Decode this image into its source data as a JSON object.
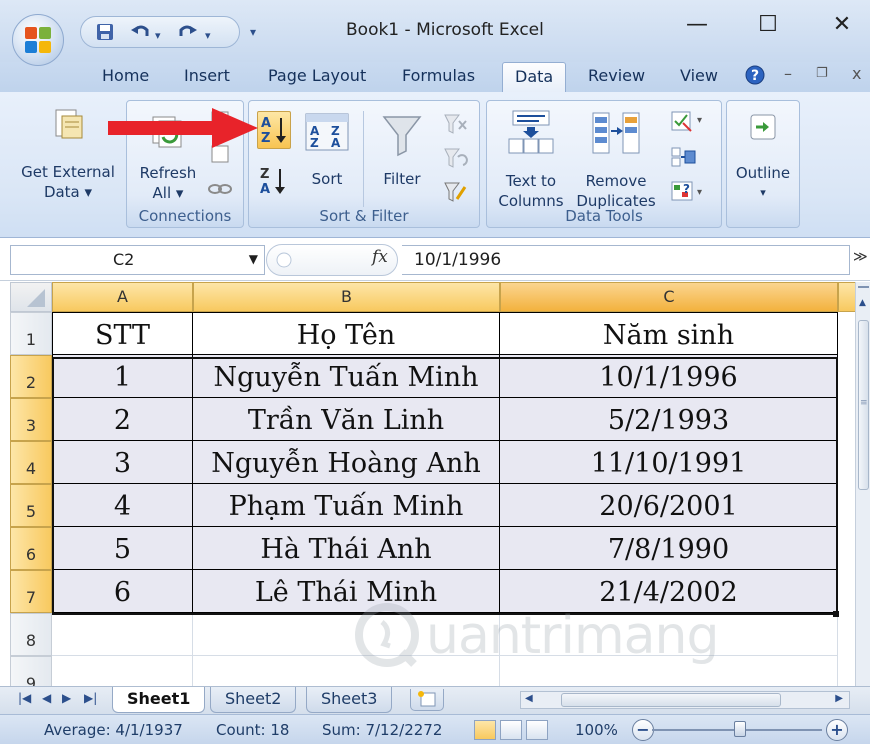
{
  "window": {
    "title": "Book1 - Microsoft Excel",
    "minimize_glyph": "—",
    "maximize_glyph": "☐",
    "close_glyph": "✕"
  },
  "quick_access": {
    "save_icon": "save-icon",
    "undo_icon": "undo-icon",
    "redo_icon": "redo-icon",
    "customize_icon": "customize-arrow-icon"
  },
  "tabs": [
    {
      "label": "Home"
    },
    {
      "label": "Insert"
    },
    {
      "label": "Page Layout"
    },
    {
      "label": "Formulas"
    },
    {
      "label": "Data"
    },
    {
      "label": "Review"
    },
    {
      "label": "View"
    }
  ],
  "active_tab": "Data",
  "ribbon": {
    "get_external_data": {
      "label_line1": "Get External",
      "label_line2": "Data ▾"
    },
    "connections": {
      "refresh_line1": "Refresh",
      "refresh_line2": "All ▾",
      "group_label": "Connections"
    },
    "sort_filter": {
      "sort_label": "Sort",
      "filter_label": "Filter",
      "group_label": "Sort & Filter"
    },
    "data_tools": {
      "text_to_columns_line1": "Text to",
      "text_to_columns_line2": "Columns",
      "remove_duplicates_line1": "Remove",
      "remove_duplicates_line2": "Duplicates",
      "group_label": "Data Tools"
    },
    "outline": {
      "label": "Outline",
      "arrow": "▾"
    }
  },
  "formula_bar": {
    "name_box": "C2",
    "fx_label": "fx",
    "formula": "10/1/1996"
  },
  "columns": [
    {
      "letter": "A",
      "selected": false
    },
    {
      "letter": "B",
      "selected": false
    },
    {
      "letter": "C",
      "selected": true
    }
  ],
  "rows": [
    {
      "num": "1",
      "cells": [
        "STT",
        "Họ Tên",
        "Năm sinh"
      ]
    },
    {
      "num": "2",
      "cells": [
        "1",
        "Nguyễn Tuấn Minh",
        "10/1/1996"
      ]
    },
    {
      "num": "3",
      "cells": [
        "2",
        "Trần Văn Linh",
        "5/2/1993"
      ]
    },
    {
      "num": "4",
      "cells": [
        "3",
        "Nguyễn Hoàng Anh",
        "11/10/1991"
      ]
    },
    {
      "num": "5",
      "cells": [
        "4",
        "Phạm Tuấn Minh",
        "20/6/2001"
      ]
    },
    {
      "num": "6",
      "cells": [
        "5",
        "Hà Thái Anh",
        "7/8/1990"
      ]
    },
    {
      "num": "7",
      "cells": [
        "6",
        "Lê Thái Minh",
        "21/4/2002"
      ]
    },
    {
      "num": "8",
      "cells": [
        "",
        "",
        ""
      ]
    },
    {
      "num": "9",
      "cells": [
        "",
        "",
        ""
      ]
    }
  ],
  "watermark": "uantrimang",
  "sheets": [
    {
      "label": "Sheet1",
      "active": true
    },
    {
      "label": "Sheet2",
      "active": false
    },
    {
      "label": "Sheet3",
      "active": false
    }
  ],
  "status": {
    "average": "Average: 4/1/1937",
    "count": "Count: 18",
    "sum": "Sum: 7/12/2272",
    "zoom": "100%",
    "zoom_level": 1.0
  },
  "colors": {
    "ribbon_bg": "#dae6f6",
    "header_selected": "#f8c95f",
    "data_fill": "#e8e8f2",
    "arrow": "#e8232a"
  }
}
